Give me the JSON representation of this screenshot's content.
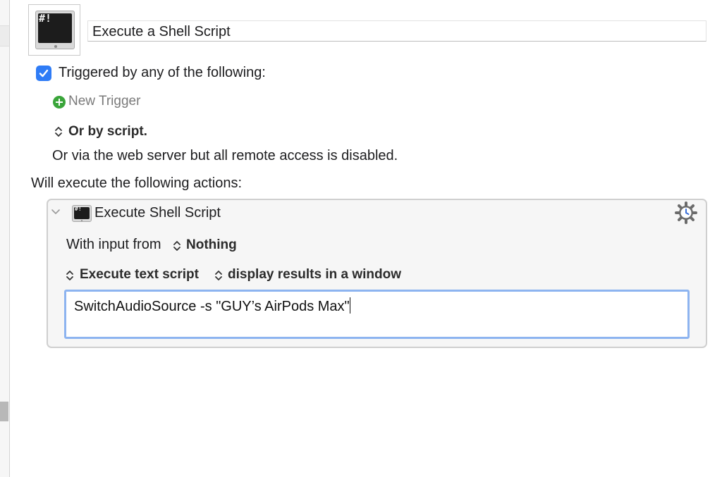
{
  "macro": {
    "name": "Execute a Shell Script",
    "icon": "terminal-icon",
    "icon_glyph": "#!"
  },
  "triggers": {
    "checked": true,
    "label": "Triggered by any of the following:",
    "new_trigger_label": "New Trigger",
    "or_by_script_label": "Or by script.",
    "web_server_note": "Or via the web server but all remote access is disabled."
  },
  "actions": {
    "heading": "Will execute the following actions:",
    "items": [
      {
        "title": "Execute Shell Script",
        "icon_glyph": "#!",
        "input_label": "With input from",
        "input_value": "Nothing",
        "mode": "Execute text script",
        "output": "display results in a window",
        "script": "SwitchAudioSource -s \"GUY’s AirPods Max\""
      }
    ]
  },
  "colors": {
    "accent": "#2f7cf6",
    "add_green": "#3aa53a",
    "focus_ring": "#8db4f0"
  }
}
